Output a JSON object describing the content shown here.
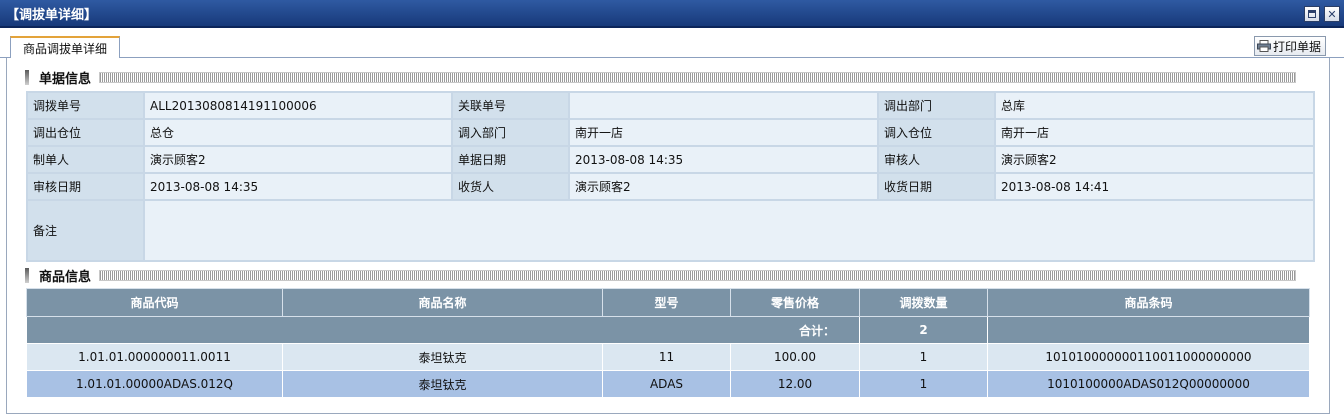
{
  "window": {
    "title": "【调拔单详细】",
    "minimize_icon": "minimize-icon",
    "close_icon": "close-icon",
    "close_glyph": "✕"
  },
  "tabs": [
    {
      "label": "商品调拔单详细",
      "active": true
    }
  ],
  "toolbar": {
    "print_label": "打印单据",
    "print_icon": "printer-icon"
  },
  "sections": {
    "doc_info": "单据信息",
    "goods_info": "商品信息"
  },
  "doc_info": {
    "transfer_no_label": "调拨单号",
    "transfer_no": "ALL2013080814191100006",
    "related_no_label": "关联单号",
    "related_no": "",
    "out_dept_label": "调出部门",
    "out_dept": "总库",
    "out_warehouse_label": "调出仓位",
    "out_warehouse": "总仓",
    "in_dept_label": "调入部门",
    "in_dept": "南开一店",
    "in_warehouse_label": "调入仓位",
    "in_warehouse": "南开一店",
    "creator_label": "制单人",
    "creator": "演示顾客2",
    "doc_date_label": "单据日期",
    "doc_date": "2013-08-08 14:35",
    "auditor_label": "审核人",
    "auditor": "演示顾客2",
    "audit_date_label": "审核日期",
    "audit_date": "2013-08-08 14:35",
    "receiver_label": "收货人",
    "receiver": "演示顾客2",
    "receive_date_label": "收货日期",
    "receive_date": "2013-08-08 14:41",
    "remark_label": "备注",
    "remark": ""
  },
  "goods": {
    "columns": [
      "商品代码",
      "商品名称",
      "型号",
      "零售价格",
      "调拨数量",
      "商品条码"
    ],
    "total_label": "合计：",
    "total_qty": "2",
    "rows": [
      {
        "code": "1.01.01.000000011.0011",
        "name": "泰坦钛克",
        "model": "11",
        "price": "100.00",
        "qty": "1",
        "barcode": "101010000000110011000000000"
      },
      {
        "code": "1.01.01.00000ADAS.012Q",
        "name": "泰坦钛克",
        "model": "ADAS",
        "price": "12.00",
        "qty": "1",
        "barcode": "1010100000ADAS012Q00000000"
      }
    ]
  },
  "colors": {
    "titlebar": "#17397a",
    "label_cell": "#d2e0ec",
    "value_cell": "#e9f1f8",
    "table_header": "#7b93a6",
    "row_light": "#dbe7f1",
    "row_selected": "#a8c1e4",
    "tab_accent": "#e3a33a"
  }
}
